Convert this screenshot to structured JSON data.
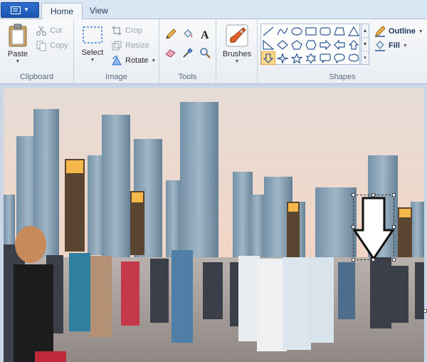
{
  "tabs": {
    "home": "Home",
    "view": "View"
  },
  "clipboard": {
    "paste": "Paste",
    "cut": "Cut",
    "copy": "Copy",
    "label": "Clipboard"
  },
  "image": {
    "select": "Select",
    "crop": "Crop",
    "resize": "Resize",
    "rotate": "Rotate",
    "label": "Image"
  },
  "tools": {
    "label": "Tools",
    "items": [
      "pencil-icon",
      "fill-bucket-icon",
      "text-icon",
      "eraser-icon",
      "color-picker-icon",
      "magnifier-icon"
    ]
  },
  "brushes": {
    "label": "Brushes"
  },
  "shapes": {
    "label": "Shapes",
    "outline": "Outline",
    "fill": "Fill",
    "selected": "down-arrow-shape"
  },
  "colors": {
    "accent": "#2f6fd0",
    "selection_highlight": "#fbd98a",
    "ribbon_bg": "#f5f6f7"
  }
}
